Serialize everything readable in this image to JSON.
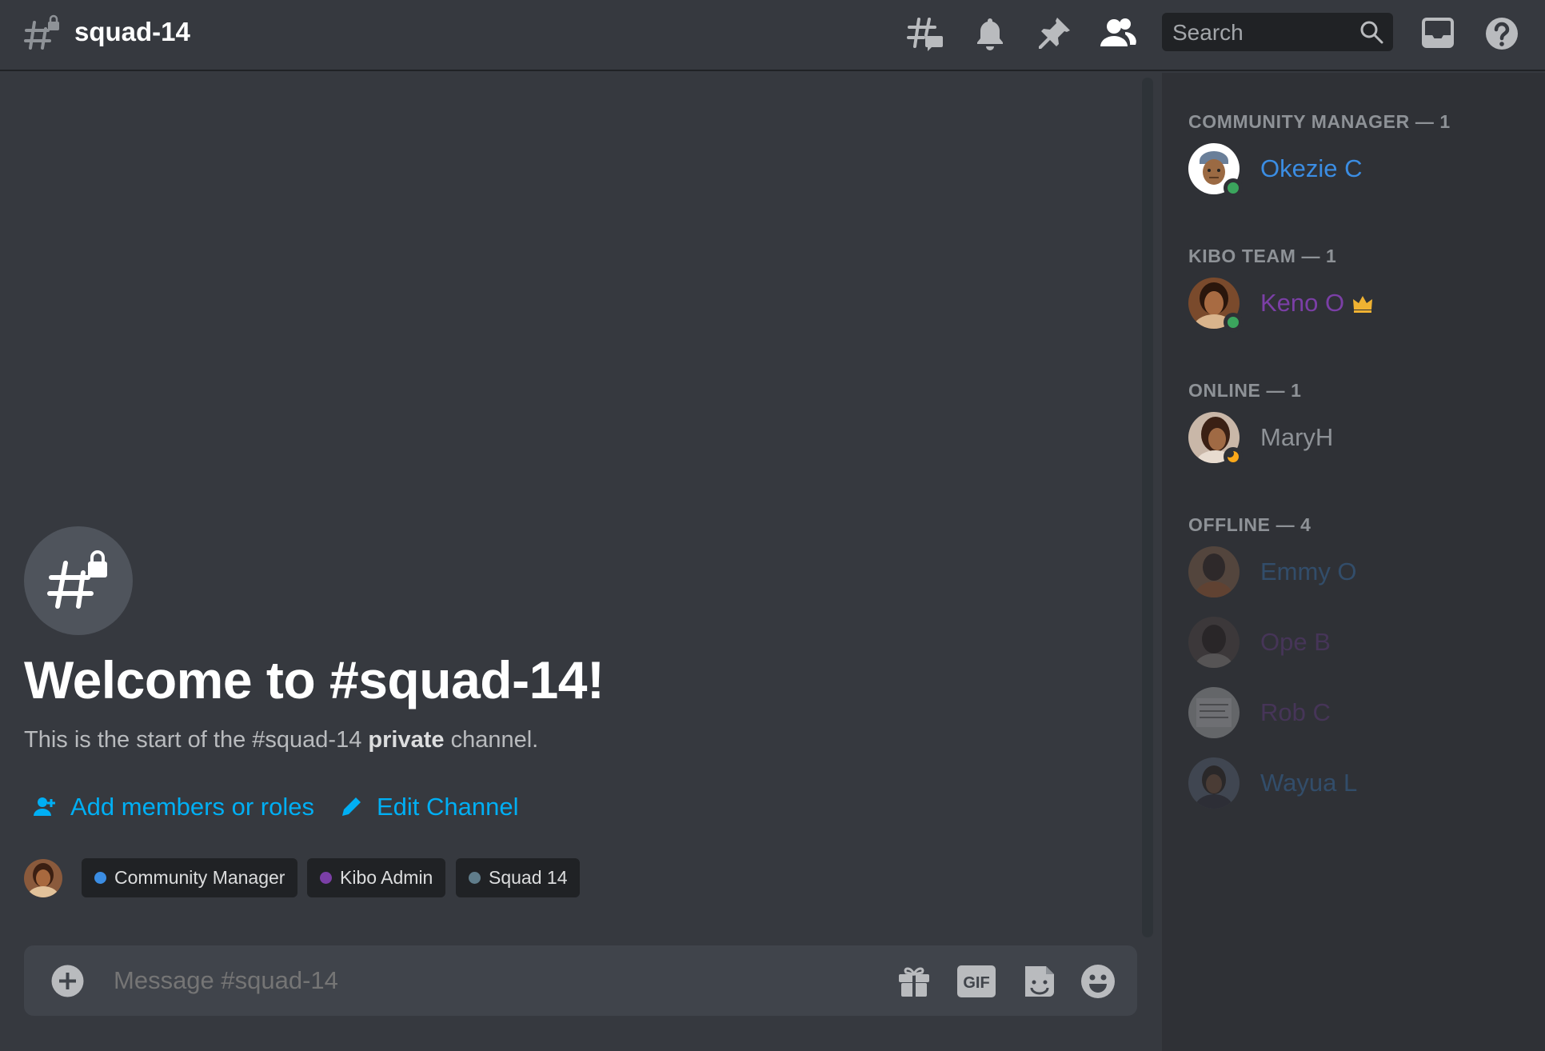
{
  "header": {
    "channel_name": "squad-14",
    "search_placeholder": "Search"
  },
  "welcome": {
    "title": "Welcome to #squad-14!",
    "subtitle_pre": "This is the start of the #squad-14 ",
    "subtitle_bold": "private",
    "subtitle_post": " channel."
  },
  "actions": {
    "add_members": "Add members or roles",
    "edit_channel": "Edit Channel"
  },
  "roles": [
    {
      "label": "Community Manager",
      "color": "#3b8de3"
    },
    {
      "label": "Kibo Admin",
      "color": "#7b3fa6"
    },
    {
      "label": "Squad 14",
      "color": "#607d8b"
    }
  ],
  "composer": {
    "placeholder": "Message #squad-14",
    "gif_label": "GIF"
  },
  "members": {
    "groups": [
      {
        "title": "COMMUNITY MANAGER — 1"
      },
      {
        "title": "KIBO TEAM — 1"
      },
      {
        "title": "ONLINE — 1"
      },
      {
        "title": "OFFLINE — 4"
      }
    ],
    "list": [
      {
        "name": "Okezie C",
        "color": "#3b8de3",
        "status": "online"
      },
      {
        "name": "Keno O",
        "color": "#7b3fa6",
        "status": "online",
        "crown": true
      },
      {
        "name": "MaryH",
        "color": "#8e9297",
        "status": "idle"
      },
      {
        "name": "Emmy O",
        "color": "#3b8de3",
        "status": "offline"
      },
      {
        "name": "Ope B",
        "color": "#7b3fa6",
        "status": "offline"
      },
      {
        "name": "Rob C",
        "color": "#7b3fa6",
        "status": "offline"
      },
      {
        "name": "Wayua L",
        "color": "#3b8de3",
        "status": "offline"
      }
    ]
  },
  "colors": {
    "accent_link": "#00aff4",
    "status_online": "#3ba55d",
    "status_idle": "#faa81a",
    "crown": "#f0b232"
  }
}
